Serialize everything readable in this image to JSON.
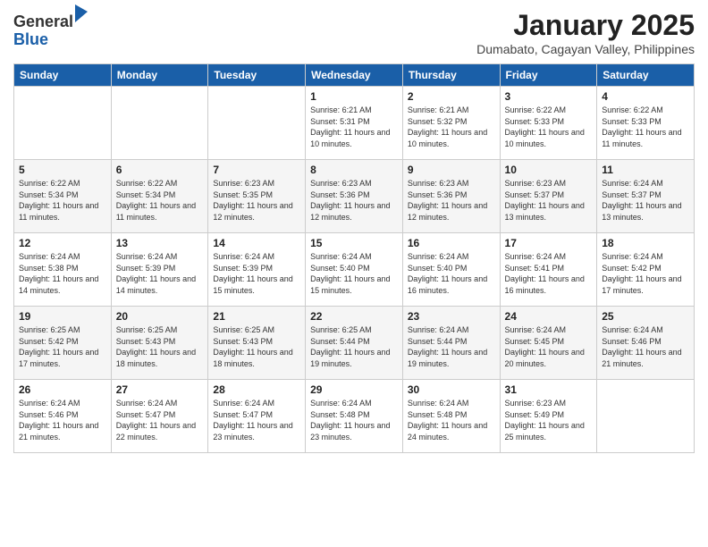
{
  "logo": {
    "general": "General",
    "blue": "Blue"
  },
  "title": "January 2025",
  "location": "Dumabato, Cagayan Valley, Philippines",
  "weekdays": [
    "Sunday",
    "Monday",
    "Tuesday",
    "Wednesday",
    "Thursday",
    "Friday",
    "Saturday"
  ],
  "weeks": [
    [
      {
        "day": "",
        "info": ""
      },
      {
        "day": "",
        "info": ""
      },
      {
        "day": "",
        "info": ""
      },
      {
        "day": "1",
        "info": "Sunrise: 6:21 AM\nSunset: 5:31 PM\nDaylight: 11 hours and 10 minutes."
      },
      {
        "day": "2",
        "info": "Sunrise: 6:21 AM\nSunset: 5:32 PM\nDaylight: 11 hours and 10 minutes."
      },
      {
        "day": "3",
        "info": "Sunrise: 6:22 AM\nSunset: 5:33 PM\nDaylight: 11 hours and 10 minutes."
      },
      {
        "day": "4",
        "info": "Sunrise: 6:22 AM\nSunset: 5:33 PM\nDaylight: 11 hours and 11 minutes."
      }
    ],
    [
      {
        "day": "5",
        "info": "Sunrise: 6:22 AM\nSunset: 5:34 PM\nDaylight: 11 hours and 11 minutes."
      },
      {
        "day": "6",
        "info": "Sunrise: 6:22 AM\nSunset: 5:34 PM\nDaylight: 11 hours and 11 minutes."
      },
      {
        "day": "7",
        "info": "Sunrise: 6:23 AM\nSunset: 5:35 PM\nDaylight: 11 hours and 12 minutes."
      },
      {
        "day": "8",
        "info": "Sunrise: 6:23 AM\nSunset: 5:36 PM\nDaylight: 11 hours and 12 minutes."
      },
      {
        "day": "9",
        "info": "Sunrise: 6:23 AM\nSunset: 5:36 PM\nDaylight: 11 hours and 12 minutes."
      },
      {
        "day": "10",
        "info": "Sunrise: 6:23 AM\nSunset: 5:37 PM\nDaylight: 11 hours and 13 minutes."
      },
      {
        "day": "11",
        "info": "Sunrise: 6:24 AM\nSunset: 5:37 PM\nDaylight: 11 hours and 13 minutes."
      }
    ],
    [
      {
        "day": "12",
        "info": "Sunrise: 6:24 AM\nSunset: 5:38 PM\nDaylight: 11 hours and 14 minutes."
      },
      {
        "day": "13",
        "info": "Sunrise: 6:24 AM\nSunset: 5:39 PM\nDaylight: 11 hours and 14 minutes."
      },
      {
        "day": "14",
        "info": "Sunrise: 6:24 AM\nSunset: 5:39 PM\nDaylight: 11 hours and 15 minutes."
      },
      {
        "day": "15",
        "info": "Sunrise: 6:24 AM\nSunset: 5:40 PM\nDaylight: 11 hours and 15 minutes."
      },
      {
        "day": "16",
        "info": "Sunrise: 6:24 AM\nSunset: 5:40 PM\nDaylight: 11 hours and 16 minutes."
      },
      {
        "day": "17",
        "info": "Sunrise: 6:24 AM\nSunset: 5:41 PM\nDaylight: 11 hours and 16 minutes."
      },
      {
        "day": "18",
        "info": "Sunrise: 6:24 AM\nSunset: 5:42 PM\nDaylight: 11 hours and 17 minutes."
      }
    ],
    [
      {
        "day": "19",
        "info": "Sunrise: 6:25 AM\nSunset: 5:42 PM\nDaylight: 11 hours and 17 minutes."
      },
      {
        "day": "20",
        "info": "Sunrise: 6:25 AM\nSunset: 5:43 PM\nDaylight: 11 hours and 18 minutes."
      },
      {
        "day": "21",
        "info": "Sunrise: 6:25 AM\nSunset: 5:43 PM\nDaylight: 11 hours and 18 minutes."
      },
      {
        "day": "22",
        "info": "Sunrise: 6:25 AM\nSunset: 5:44 PM\nDaylight: 11 hours and 19 minutes."
      },
      {
        "day": "23",
        "info": "Sunrise: 6:24 AM\nSunset: 5:44 PM\nDaylight: 11 hours and 19 minutes."
      },
      {
        "day": "24",
        "info": "Sunrise: 6:24 AM\nSunset: 5:45 PM\nDaylight: 11 hours and 20 minutes."
      },
      {
        "day": "25",
        "info": "Sunrise: 6:24 AM\nSunset: 5:46 PM\nDaylight: 11 hours and 21 minutes."
      }
    ],
    [
      {
        "day": "26",
        "info": "Sunrise: 6:24 AM\nSunset: 5:46 PM\nDaylight: 11 hours and 21 minutes."
      },
      {
        "day": "27",
        "info": "Sunrise: 6:24 AM\nSunset: 5:47 PM\nDaylight: 11 hours and 22 minutes."
      },
      {
        "day": "28",
        "info": "Sunrise: 6:24 AM\nSunset: 5:47 PM\nDaylight: 11 hours and 23 minutes."
      },
      {
        "day": "29",
        "info": "Sunrise: 6:24 AM\nSunset: 5:48 PM\nDaylight: 11 hours and 23 minutes."
      },
      {
        "day": "30",
        "info": "Sunrise: 6:24 AM\nSunset: 5:48 PM\nDaylight: 11 hours and 24 minutes."
      },
      {
        "day": "31",
        "info": "Sunrise: 6:23 AM\nSunset: 5:49 PM\nDaylight: 11 hours and 25 minutes."
      },
      {
        "day": "",
        "info": ""
      }
    ]
  ]
}
